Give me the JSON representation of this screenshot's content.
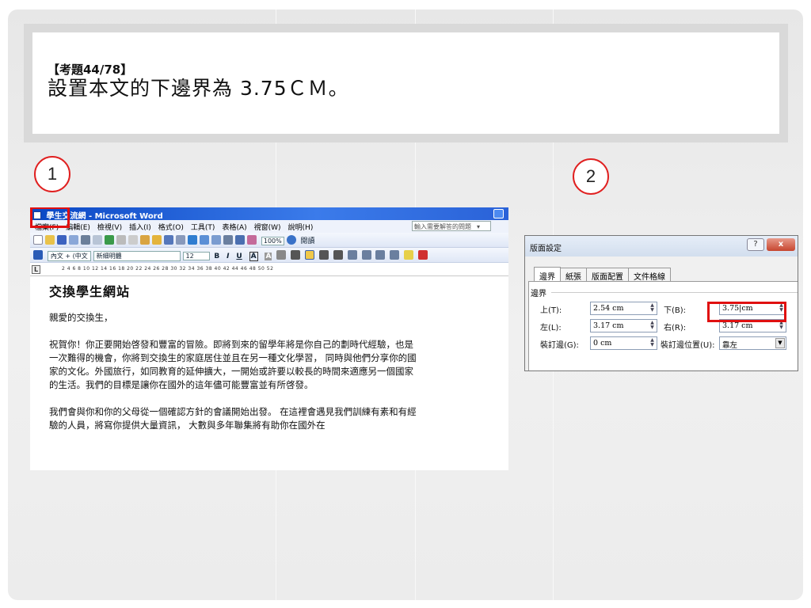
{
  "question": {
    "tag": "【考題44/78】",
    "text": "設置本文的下邊界為 3.75ＣＭ。"
  },
  "steps": [
    "1",
    "2"
  ],
  "word": {
    "window_title": "學生交流網 - Microsoft Word",
    "menu": [
      "檔案(F)",
      "編輯(E)",
      "檢視(V)",
      "插入(I)",
      "格式(O)",
      "工具(T)",
      "表格(A)",
      "視窗(W)",
      "說明(H)"
    ],
    "ask_placeholder": "輸入需要解答的問題",
    "zoom": "100%",
    "reading_label": "閱讀",
    "style_box": "內文 + (中文",
    "font_box": "新細明體",
    "size_box": "12",
    "format_buttons": [
      "B",
      "I",
      "U",
      "A",
      "A"
    ],
    "ruler_numbers": "2   4   6   8   10   12   14   16   18   20   22   24   26   28   30   32   34   36   38   40   42   44   46   48   50   52",
    "doc": {
      "title": "交換學生網站",
      "greeting": "親愛的交換生，",
      "para1": "祝賀你！你正要開始啓發和豐富的冒險。即將到來的留學年將是你自己的劃時代經驗，也是一次難得的機會，你將到交換生的家庭居住並且在另一種文化學習， 同時與他們分享你的國家的文化。外國旅行，如同教育的延伸擴大，一開始或許要以較長的時間來適應另一個國家的生活。我們的目標是讓你在國外的這年儘可能豐富並有所啓發。",
      "para2": "我們會與你和你的父母從一個確認方針的會議開始出發。 在這裡會遇見我們訓練有素和有經驗的人員，將寫你提供大量資訊， 大數與多年聯集將有助你在國外在"
    }
  },
  "dialog": {
    "title": "版面設定",
    "help": "?",
    "close": "x",
    "tabs": [
      "邊界",
      "紙張",
      "版面配置",
      "文件格線"
    ],
    "group": "邊界",
    "fields": {
      "top_label": "上(T):",
      "top_value": "2.54 cm",
      "bottom_label": "下(B):",
      "bottom_value": "3.75|cm",
      "left_label": "左(L):",
      "left_value": "3.17 cm",
      "right_label": "右(R):",
      "right_value": "3.17 cm",
      "gutter_label": "裝訂邊(G):",
      "gutter_value": "0 cm",
      "gutter_pos_label": "裝訂邊位置(U):",
      "gutter_pos_value": "靠左"
    }
  },
  "colors": {
    "highlight": "#e01010",
    "step_circle": "#e02020",
    "word_titlebar": "#0a47c4"
  }
}
